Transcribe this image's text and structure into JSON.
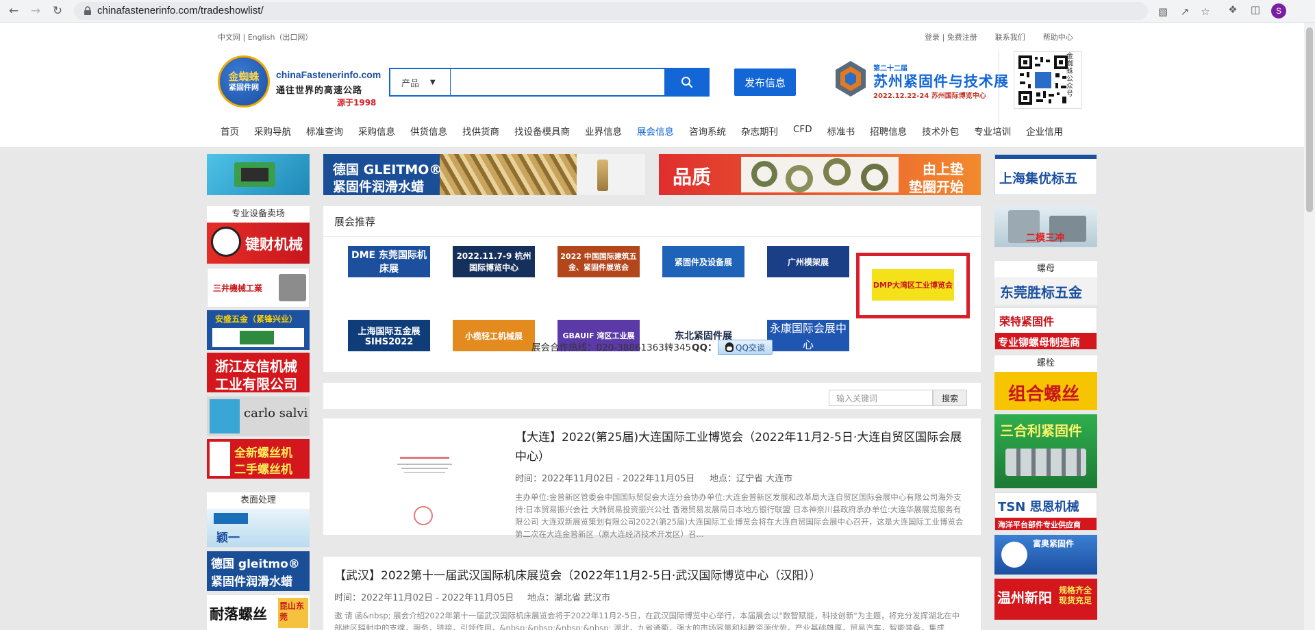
{
  "browser": {
    "url": "chinafastenerinfo.com/tradeshowlist/",
    "profile_initial": "S"
  },
  "top_links": {
    "left": "中文网 | English（出口网）",
    "right": [
      "登录 | 免费注册",
      "联系我们",
      "帮助中心"
    ]
  },
  "logo": {
    "cn_line1": "金蜘蛛",
    "cn_line2": "紧固件网",
    "domain": "chinaFastenerinfo.com",
    "slogan": "通往世界的高速公路",
    "since": "源于1998"
  },
  "search": {
    "category": "产品",
    "placeholder": ""
  },
  "publish_label": "发布信息",
  "expo_banner": {
    "session": "第二十二届",
    "title": "苏州紧固件与技术展",
    "date": "2022.12.22-24  苏州国际博览中心"
  },
  "qr_label": "金蜘蛛公众号",
  "nav": [
    "首页",
    "采购导航",
    "标准查询",
    "采购信息",
    "供货信息",
    "找供货商",
    "找设备模具商",
    "业界信息",
    "展会信息",
    "咨询系统",
    "杂志期刊",
    "CFD",
    "标准书",
    "招聘信息",
    "技术外包",
    "专业培训",
    "企业信用"
  ],
  "nav_active": "展会信息",
  "banners": {
    "gleitmo_line1": "德国 GLEITMO®",
    "gleitmo_line2": "紧固件润滑水蜡",
    "quality_word": "品质",
    "quality_line1": "由上垫",
    "quality_line2": "垫圈开始"
  },
  "left_sidebar": {
    "section1_title": "专业设备卖场",
    "ads": [
      "键财机械",
      "三井機械工業",
      "安盛五金（紧锋兴业）",
      "浙江友信机械",
      "工业有限公司",
      "carlo salvi",
      "全新螺丝机",
      "二手螺丝机"
    ],
    "section2_title": "表面处理",
    "ads2": [
      "颖一",
      "德国 gleitmo®",
      "紧固件润滑水蜡",
      "耐落螺丝",
      "昆山东莞"
    ]
  },
  "right_sidebar": {
    "ad1": "上海集优标五",
    "ad2": "二模三冲",
    "section1_title": "螺母",
    "ad3": "东莞胜标五金",
    "ad4": "荣特紧固件",
    "ad4_sub": "专业铆螺母制造商",
    "section2_title": "螺栓",
    "ad5": "组合螺丝",
    "ad6": "三合利紧固件",
    "ad7": "TSN 思恩机械",
    "ad7_sub": "海洋平台部件专业供应商",
    "ad8": "富奥紧固件",
    "ad9": "温州新阳",
    "ad9_sub": "规格齐全 现货充足"
  },
  "exhibitions": {
    "title": "展会推荐",
    "logos": [
      "DME 东莞国际机床展",
      "2022.11.7-9 杭州国际博览中心",
      "2022 中国国际建筑五金、紧固件展览会",
      "紧固件及设备展",
      "广州模架展",
      "DMP大湾区工业博览会",
      "上海国际五金展 SIHS2022",
      "小榄轻工机械展",
      "GBAUIF 湾区工业展",
      "东北紧固件展",
      "永康国际会展中心"
    ],
    "hotline": "展会合作热线：020-38861363转345",
    "qq_label": "QQ：",
    "qq_button": "QQ交谈"
  },
  "list_search": {
    "placeholder": "输入关键词",
    "button": "搜索"
  },
  "list": [
    {
      "title": "【大连】2022(第25届)大连国际工业博览会（2022年11月2-5日·大连自贸区国际会展中心）",
      "time": "时间：2022年11月02日 - 2022年11月05日",
      "place": "地点：辽宁省 大连市",
      "desc": "主办单位:金普新区管委会中国国际贸促会大连分会协办单位:大连金普新区发展和改革局大连自贸区国际会展中心有限公司海外支持:日本贸易振兴会社 大韩贸易投资振兴公社 香港贸易发展局日本地方银行联盟 日本神奈川县政府承办单位:大连华展展览服务有限公司  大连双新展览策划有限公司2022(第25届)大连国际工业博览会将在大连自贸国际会展中心召开，这是大连国际工业博览会第二次在大连金普新区（原大连经济技术开发区）召..."
    },
    {
      "title": "【武汉】2022第十一届武汉国际机床展览会（2022年11月2-5日·武汉国际博览中心（汉阳））",
      "time": "时间：2022年11月02日 - 2022年11月05日",
      "place": "地点：湖北省 武汉市",
      "desc": "邀 请 函&nbsp; 展会介绍2022年第十一届武汉国际机床展览会将于2022年11月2-5日，在武汉国际博览中心举行，本届展会以\"数智赋能，科技创新\"为主题，将充分发挥湖北在中部地区辐射中的支撑，服务，链接，引领作用，&nbsp;&nbsp;&nbsp;&nbsp; 湖北，九省通衢，强大的市场容量和科教资源优势，产业基础雄厚，贸易汽车，智能装备，集成"
    }
  ]
}
